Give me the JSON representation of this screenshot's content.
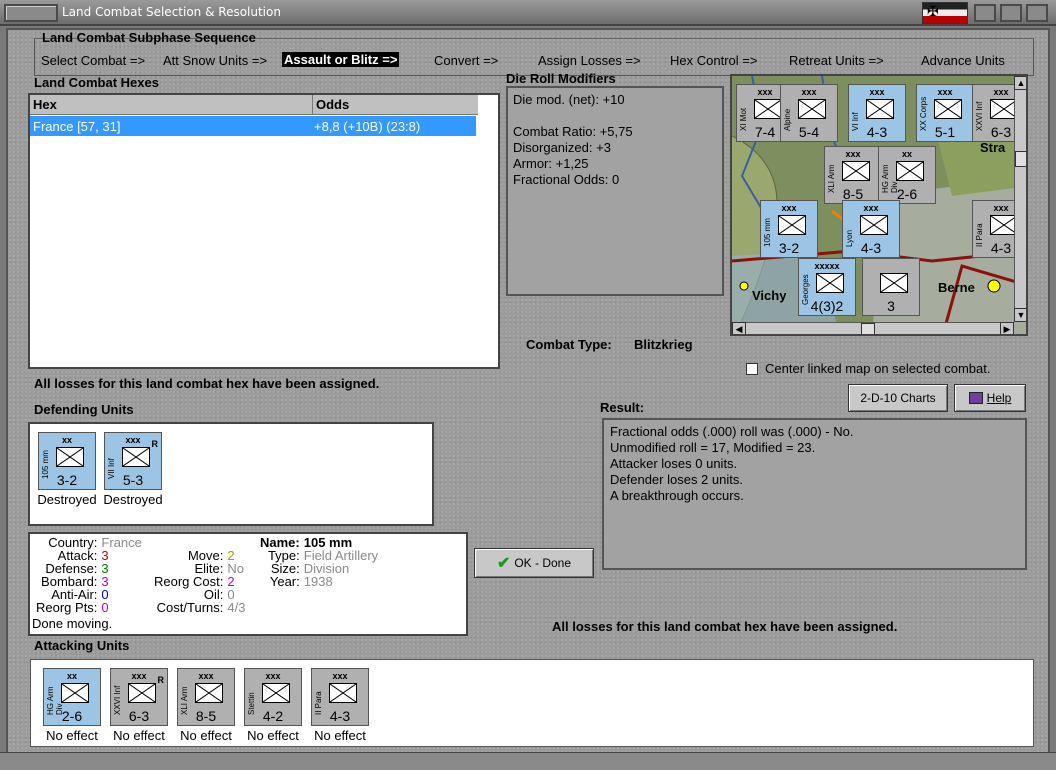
{
  "window": {
    "title": "Land Combat Selection & Resolution"
  },
  "sequence": {
    "heading": "Land Combat Subphase Sequence",
    "steps": [
      "Select Combat =>",
      "Att Snow Units =>",
      "Assault or Blitz =>",
      "Convert =>",
      "Assign Losses =>",
      "Hex Control =>",
      "Retreat Units =>",
      "Advance Units"
    ],
    "active_index": 2
  },
  "hexes": {
    "heading": "Land Combat Hexes",
    "columns": [
      "Hex",
      "Odds"
    ],
    "rows": [
      {
        "hex": "France [57, 31]",
        "odds": "+8,8 (+10B) (23:8)"
      }
    ]
  },
  "modifiers": {
    "heading": "Die Roll Modifiers",
    "lines": [
      "Die mod. (net): +10",
      "",
      "Combat Ratio: +5,75",
      "Disorganized: +3",
      "Armor: +1,25",
      "Fractional Odds: 0"
    ]
  },
  "combat_type": {
    "label": "Combat Type:",
    "value": "Blitzkrieg"
  },
  "center_map": {
    "label": "Center linked map on selected combat.",
    "checked": false
  },
  "losses_note_top": "All losses for this land combat hex have been assigned.",
  "losses_note_bottom": "All losses for this land combat hex have been assigned.",
  "buttons": {
    "charts": "2-D-10 Charts",
    "help": "Help",
    "ok": "OK - Done"
  },
  "defending": {
    "heading": "Defending Units",
    "units": [
      {
        "size": "xx",
        "name": "105 mm",
        "values": "3-2",
        "status": "Destroyed",
        "r": ""
      },
      {
        "size": "xxx",
        "name": "VII Inf",
        "values": "5-3",
        "status": "Destroyed",
        "r": "R"
      }
    ]
  },
  "unit_info": {
    "country_label": "Country:",
    "country": "France",
    "attack_label": "Attack:",
    "attack": "3",
    "defense_label": "Defense:",
    "defense": "3",
    "bombard_label": "Bombard:",
    "bombard": "3",
    "antiair_label": "Anti-Air:",
    "antiair": "0",
    "reorg_pts_label": "Reorg Pts:",
    "reorg_pts": "0",
    "done": "Done moving.",
    "move_label": "Move:",
    "move": "2",
    "elite_label": "Elite:",
    "elite": "No",
    "reorg_cost_label": "Reorg Cost:",
    "reorg_cost": "2",
    "oil_label": "Oil:",
    "oil": "0",
    "cost_turns_label": "Cost/Turns:",
    "cost_turns": "4/3",
    "name_label": "Name:",
    "name": "105 mm",
    "type_label": "Type:",
    "type": "Field Artillery",
    "size_label": "Size:",
    "size": "Division",
    "year_label": "Year:",
    "year": "1938"
  },
  "result": {
    "heading": "Result:",
    "lines": [
      "Fractional odds (.000) roll was (.000)  - No.",
      "Unmodified roll = 17, Modified = 23.",
      "Attacker loses 0 units.",
      "Defender loses 2 units.",
      "A breakthrough occurs."
    ]
  },
  "attacking": {
    "heading": "Attacking Units",
    "units": [
      {
        "size": "xx",
        "name": "HG Arm Div",
        "values": "2-6",
        "status": "No effect",
        "r": "",
        "gray": false
      },
      {
        "size": "xxx",
        "name": "XXVI Inf",
        "values": "6-3",
        "status": "No effect",
        "r": "R",
        "gray": true
      },
      {
        "size": "xxx",
        "name": "XLI Arm",
        "values": "8-5",
        "status": "No effect",
        "r": "",
        "gray": true
      },
      {
        "size": "xxx",
        "name": "Stettin",
        "values": "4-2",
        "status": "No effect",
        "r": "",
        "gray": true
      },
      {
        "size": "xxx",
        "name": "II Para",
        "values": "4-3",
        "status": "No effect",
        "r": "",
        "gray": true
      }
    ]
  },
  "map": {
    "labels": [
      "Vichy",
      "Berne",
      "Stra"
    ],
    "counters": [
      {
        "size": "xxx",
        "name": "XI Mot",
        "values": "7-4",
        "gray": true
      },
      {
        "size": "xxx",
        "name": "Alpine",
        "values": "5-4",
        "gray": true
      },
      {
        "size": "xxx",
        "name": "VI Inf",
        "values": "4-3",
        "gray": false
      },
      {
        "size": "xxx",
        "name": "XX Corps",
        "values": "5-1",
        "gray": false
      },
      {
        "size": "xxx",
        "name": "XXVI Inf",
        "values": "6-3",
        "gray": true
      },
      {
        "size": "xxx",
        "name": "XLI Arm",
        "values": "8-5",
        "gray": true
      },
      {
        "size": "xx",
        "name": "HG Arm Div",
        "values": "2-6",
        "gray": true
      },
      {
        "size": "xxx",
        "name": "105 mm",
        "values": "3-2",
        "gray": false
      },
      {
        "size": "xxx",
        "name": "Lyon",
        "values": "4-3",
        "gray": false
      },
      {
        "size": "xxx",
        "name": "II Para",
        "values": "4-3",
        "gray": true
      },
      {
        "size": "xxxxx",
        "name": "Georges",
        "values": "4(3)2",
        "gray": false
      },
      {
        "size": "",
        "name": "",
        "values": "3",
        "gray": true
      }
    ]
  },
  "colors": {
    "attack": "#d00000",
    "defense": "#008000",
    "bombard": "#c000c0",
    "antiair": "#0000d0",
    "muted": "#8a8a8a",
    "counter_blue": "#9cc4e4",
    "counter_gray": "#b0b0b0",
    "selection": "#3399ff"
  }
}
